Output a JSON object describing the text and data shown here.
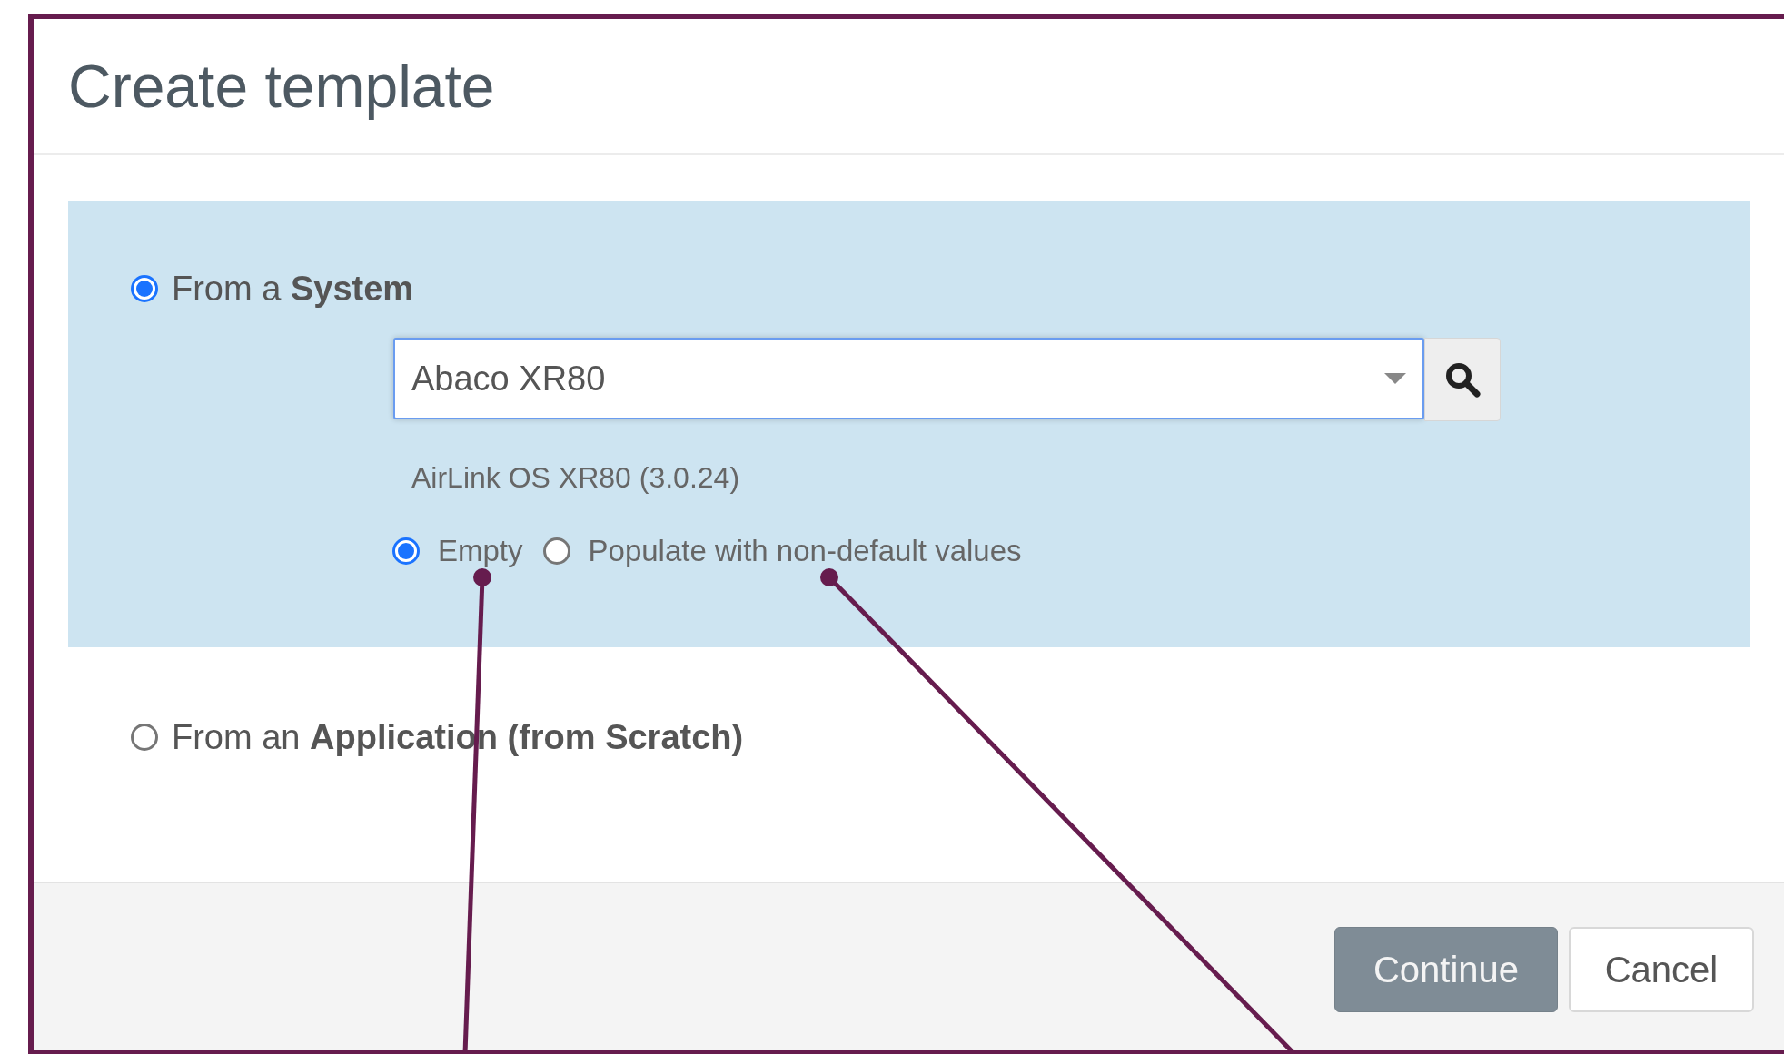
{
  "dialog": {
    "title": "Create template"
  },
  "sources": [
    {
      "label": "From a **System**",
      "selected": true,
      "highlighted": true,
      "system_select": {
        "value": "Abaco XR80"
      },
      "description": "AirLink OS XR80 (3.0.24)",
      "options": [
        {
          "label": "Empty",
          "selected": true
        },
        {
          "label": "Populate with non-default values",
          "selected": false
        }
      ]
    },
    {
      "label": "From an **Application (from Scratch)**",
      "selected": false,
      "highlighted": false
    }
  ],
  "buttons": [
    {
      "label": "Continue",
      "kind": "primary",
      "disabled": true
    },
    {
      "label": "Cancel",
      "kind": "secondary",
      "disabled": false
    }
  ]
}
